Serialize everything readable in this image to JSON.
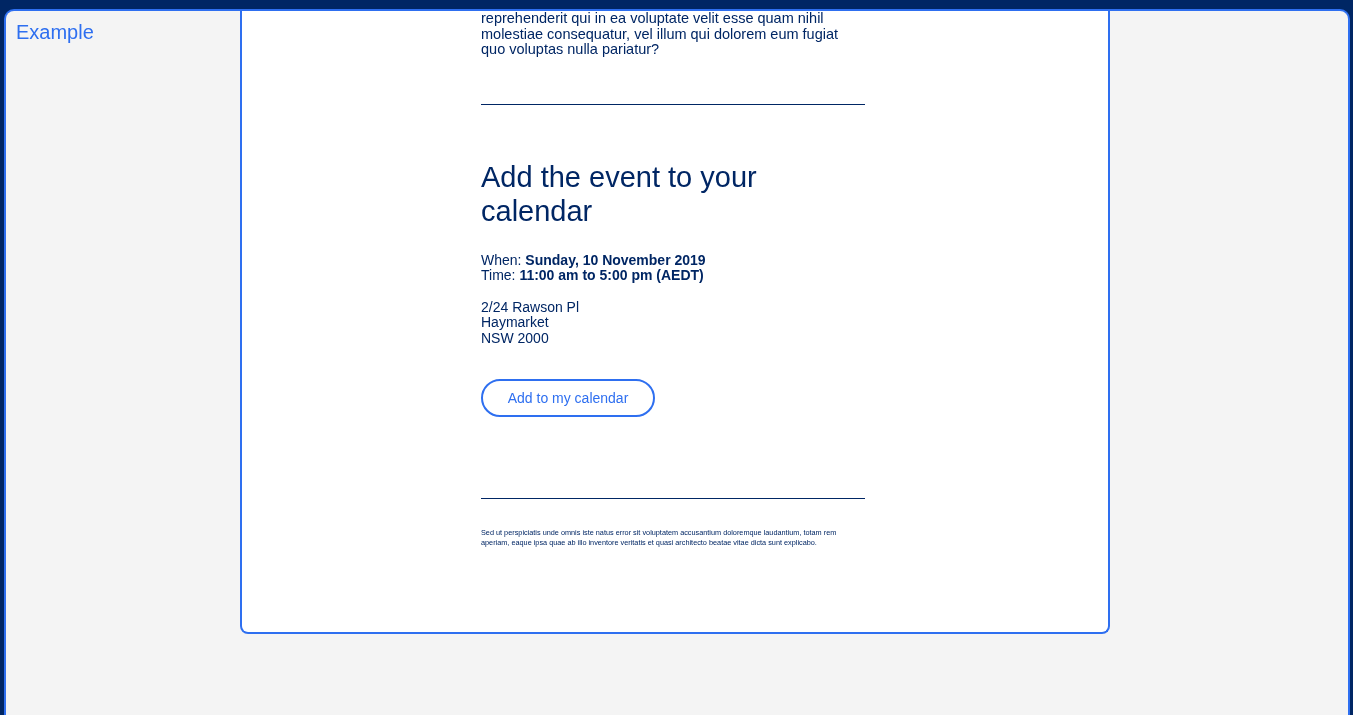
{
  "sidebar": {
    "title": "Example"
  },
  "email": {
    "intro_text": "reprehenderit qui in ea voluptate velit esse quam nihil molestiae consequatur, vel illum qui dolorem eum fugiat quo voluptas nulla pariatur?",
    "heading": "Add the event to your calendar",
    "when": "When: **Sunday, 10 November 2019**",
    "time": "Time: **11:00 am to 5:00 pm (AEDT)**",
    "address": [
      "2/24 Rawson Pl",
      "Haymarket",
      "NSW 2000"
    ],
    "button": "Add to my calendar",
    "footer_text": "Sed ut perspiciatis unde omnis iste natus error sit voluptatem accusantium doloremque laudantium, totam rem aperiam, eaque ipsa quae ab illo inventore veritatis et quasi architecto beatae vitae dicta sunt explicabo."
  }
}
